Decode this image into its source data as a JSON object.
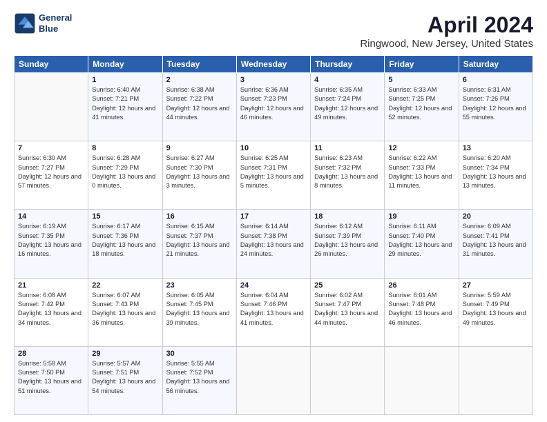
{
  "header": {
    "logo_line1": "General",
    "logo_line2": "Blue",
    "title": "April 2024",
    "subtitle": "Ringwood, New Jersey, United States"
  },
  "columns": [
    "Sunday",
    "Monday",
    "Tuesday",
    "Wednesday",
    "Thursday",
    "Friday",
    "Saturday"
  ],
  "weeks": [
    [
      {
        "num": "",
        "sunrise": "",
        "sunset": "",
        "daylight": ""
      },
      {
        "num": "1",
        "sunrise": "Sunrise: 6:40 AM",
        "sunset": "Sunset: 7:21 PM",
        "daylight": "Daylight: 12 hours and 41 minutes."
      },
      {
        "num": "2",
        "sunrise": "Sunrise: 6:38 AM",
        "sunset": "Sunset: 7:22 PM",
        "daylight": "Daylight: 12 hours and 44 minutes."
      },
      {
        "num": "3",
        "sunrise": "Sunrise: 6:36 AM",
        "sunset": "Sunset: 7:23 PM",
        "daylight": "Daylight: 12 hours and 46 minutes."
      },
      {
        "num": "4",
        "sunrise": "Sunrise: 6:35 AM",
        "sunset": "Sunset: 7:24 PM",
        "daylight": "Daylight: 12 hours and 49 minutes."
      },
      {
        "num": "5",
        "sunrise": "Sunrise: 6:33 AM",
        "sunset": "Sunset: 7:25 PM",
        "daylight": "Daylight: 12 hours and 52 minutes."
      },
      {
        "num": "6",
        "sunrise": "Sunrise: 6:31 AM",
        "sunset": "Sunset: 7:26 PM",
        "daylight": "Daylight: 12 hours and 55 minutes."
      }
    ],
    [
      {
        "num": "7",
        "sunrise": "Sunrise: 6:30 AM",
        "sunset": "Sunset: 7:27 PM",
        "daylight": "Daylight: 12 hours and 57 minutes."
      },
      {
        "num": "8",
        "sunrise": "Sunrise: 6:28 AM",
        "sunset": "Sunset: 7:29 PM",
        "daylight": "Daylight: 13 hours and 0 minutes."
      },
      {
        "num": "9",
        "sunrise": "Sunrise: 6:27 AM",
        "sunset": "Sunset: 7:30 PM",
        "daylight": "Daylight: 13 hours and 3 minutes."
      },
      {
        "num": "10",
        "sunrise": "Sunrise: 6:25 AM",
        "sunset": "Sunset: 7:31 PM",
        "daylight": "Daylight: 13 hours and 5 minutes."
      },
      {
        "num": "11",
        "sunrise": "Sunrise: 6:23 AM",
        "sunset": "Sunset: 7:32 PM",
        "daylight": "Daylight: 13 hours and 8 minutes."
      },
      {
        "num": "12",
        "sunrise": "Sunrise: 6:22 AM",
        "sunset": "Sunset: 7:33 PM",
        "daylight": "Daylight: 13 hours and 11 minutes."
      },
      {
        "num": "13",
        "sunrise": "Sunrise: 6:20 AM",
        "sunset": "Sunset: 7:34 PM",
        "daylight": "Daylight: 13 hours and 13 minutes."
      }
    ],
    [
      {
        "num": "14",
        "sunrise": "Sunrise: 6:19 AM",
        "sunset": "Sunset: 7:35 PM",
        "daylight": "Daylight: 13 hours and 16 minutes."
      },
      {
        "num": "15",
        "sunrise": "Sunrise: 6:17 AM",
        "sunset": "Sunset: 7:36 PM",
        "daylight": "Daylight: 13 hours and 18 minutes."
      },
      {
        "num": "16",
        "sunrise": "Sunrise: 6:15 AM",
        "sunset": "Sunset: 7:37 PM",
        "daylight": "Daylight: 13 hours and 21 minutes."
      },
      {
        "num": "17",
        "sunrise": "Sunrise: 6:14 AM",
        "sunset": "Sunset: 7:38 PM",
        "daylight": "Daylight: 13 hours and 24 minutes."
      },
      {
        "num": "18",
        "sunrise": "Sunrise: 6:12 AM",
        "sunset": "Sunset: 7:39 PM",
        "daylight": "Daylight: 13 hours and 26 minutes."
      },
      {
        "num": "19",
        "sunrise": "Sunrise: 6:11 AM",
        "sunset": "Sunset: 7:40 PM",
        "daylight": "Daylight: 13 hours and 29 minutes."
      },
      {
        "num": "20",
        "sunrise": "Sunrise: 6:09 AM",
        "sunset": "Sunset: 7:41 PM",
        "daylight": "Daylight: 13 hours and 31 minutes."
      }
    ],
    [
      {
        "num": "21",
        "sunrise": "Sunrise: 6:08 AM",
        "sunset": "Sunset: 7:42 PM",
        "daylight": "Daylight: 13 hours and 34 minutes."
      },
      {
        "num": "22",
        "sunrise": "Sunrise: 6:07 AM",
        "sunset": "Sunset: 7:43 PM",
        "daylight": "Daylight: 13 hours and 36 minutes."
      },
      {
        "num": "23",
        "sunrise": "Sunrise: 6:05 AM",
        "sunset": "Sunset: 7:45 PM",
        "daylight": "Daylight: 13 hours and 39 minutes."
      },
      {
        "num": "24",
        "sunrise": "Sunrise: 6:04 AM",
        "sunset": "Sunset: 7:46 PM",
        "daylight": "Daylight: 13 hours and 41 minutes."
      },
      {
        "num": "25",
        "sunrise": "Sunrise: 6:02 AM",
        "sunset": "Sunset: 7:47 PM",
        "daylight": "Daylight: 13 hours and 44 minutes."
      },
      {
        "num": "26",
        "sunrise": "Sunrise: 6:01 AM",
        "sunset": "Sunset: 7:48 PM",
        "daylight": "Daylight: 13 hours and 46 minutes."
      },
      {
        "num": "27",
        "sunrise": "Sunrise: 5:59 AM",
        "sunset": "Sunset: 7:49 PM",
        "daylight": "Daylight: 13 hours and 49 minutes."
      }
    ],
    [
      {
        "num": "28",
        "sunrise": "Sunrise: 5:58 AM",
        "sunset": "Sunset: 7:50 PM",
        "daylight": "Daylight: 13 hours and 51 minutes."
      },
      {
        "num": "29",
        "sunrise": "Sunrise: 5:57 AM",
        "sunset": "Sunset: 7:51 PM",
        "daylight": "Daylight: 13 hours and 54 minutes."
      },
      {
        "num": "30",
        "sunrise": "Sunrise: 5:55 AM",
        "sunset": "Sunset: 7:52 PM",
        "daylight": "Daylight: 13 hours and 56 minutes."
      },
      {
        "num": "",
        "sunrise": "",
        "sunset": "",
        "daylight": ""
      },
      {
        "num": "",
        "sunrise": "",
        "sunset": "",
        "daylight": ""
      },
      {
        "num": "",
        "sunrise": "",
        "sunset": "",
        "daylight": ""
      },
      {
        "num": "",
        "sunrise": "",
        "sunset": "",
        "daylight": ""
      }
    ]
  ]
}
